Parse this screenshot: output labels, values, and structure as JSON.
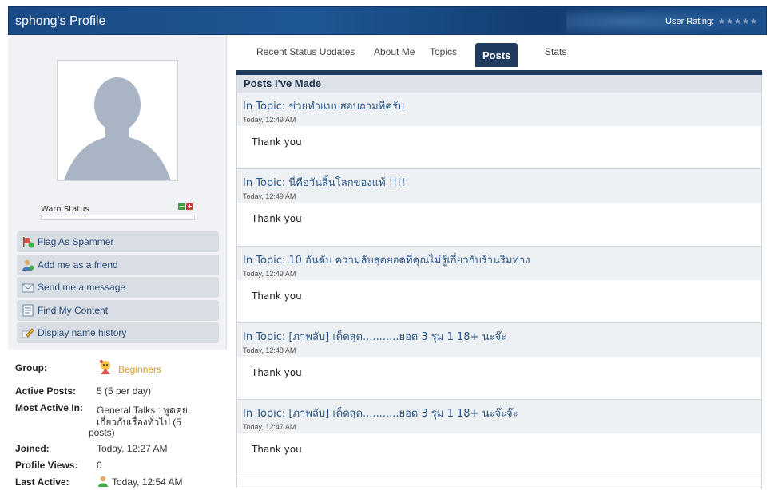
{
  "header": {
    "title": "sphong's Profile",
    "rating_label": "User Rating:",
    "stars": "★★★★★"
  },
  "sidebar": {
    "warn_label": "Warn Status",
    "actions": [
      {
        "label": "Flag As Spammer",
        "icon": "flag-icon"
      },
      {
        "label": "Add me as a friend",
        "icon": "add-friend-icon"
      },
      {
        "label": "Send me a message",
        "icon": "envelope-icon"
      },
      {
        "label": "Find My Content",
        "icon": "document-icon"
      },
      {
        "label": "Display name history",
        "icon": "pencil-icon"
      }
    ],
    "info": {
      "group_key": "Group:",
      "group_value": "Beginners",
      "active_posts_key": "Active Posts:",
      "active_posts_value": "5 (5 per day)",
      "most_active_key": "Most Active In:",
      "most_active_line1": "General Talks : พูดคุย",
      "most_active_line2": "เกี่ยวกับเรื่องทั่วไป (5",
      "most_active_line3": "posts)",
      "joined_key": "Joined:",
      "joined_value": "Today, 12:27 AM",
      "views_key": "Profile Views:",
      "views_value": "0",
      "last_active_key": "Last Active:",
      "last_active_value": "Today, 12:54 AM"
    }
  },
  "tabs": [
    "Recent Status Updates",
    "About Me",
    "Topics",
    "Posts",
    "Stats"
  ],
  "active_tab": "Posts",
  "panel": {
    "heading": "Posts I've Made",
    "posts": [
      {
        "title": "In Topic: ช่วยทำแบบสอบถามทีครับ",
        "time": "Today, 12:49 AM",
        "body": "Thank you"
      },
      {
        "title": "In Topic: นี่คือวันสิ้นโลกของแท้ !!!!",
        "time": "Today, 12:49 AM",
        "body": "Thank you"
      },
      {
        "title": "In Topic: 10 อันดับ ความลับสุดยอดที่คุณไม่รู้เกี่ยวกับร้านริมทาง",
        "time": "Today, 12:49 AM",
        "body": "Thank you"
      },
      {
        "title": "In Topic: [ภาพลับ] เด็ดสุด...........ยอด 3 รุม 1 18+ นะจ๊ะ",
        "time": "Today, 12:48 AM",
        "body": "Thank you"
      },
      {
        "title": "In Topic: [ภาพลับ] เด็ดสุด...........ยอด 3 รุม 1 18+ นะจ๊ะจ๊ะ",
        "time": "Today, 12:47 AM",
        "body": "Thank you"
      }
    ]
  },
  "colors": {
    "header_bg": "#1a4a85",
    "tab_active": "#1f3a5f",
    "link": "#2b5788",
    "group": "#d4a017"
  }
}
